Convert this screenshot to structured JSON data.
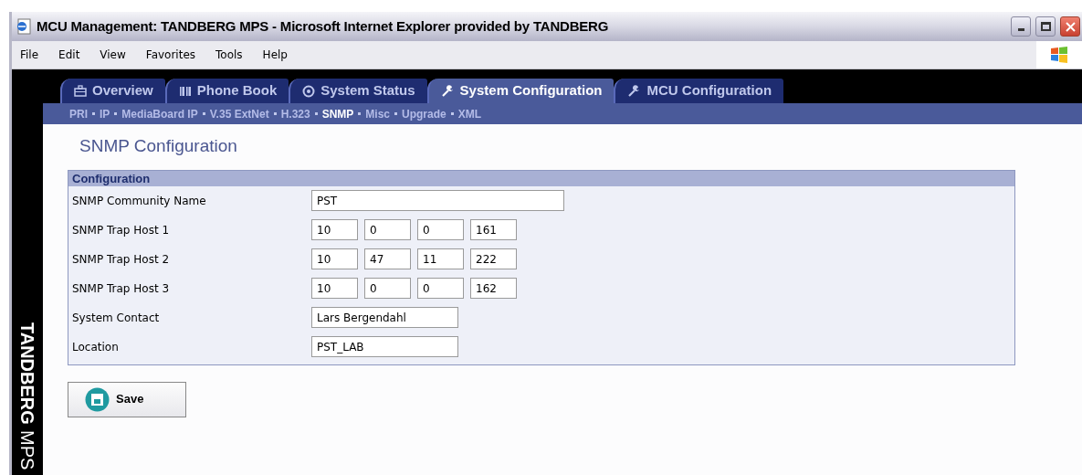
{
  "window": {
    "title": "MCU Management: TANDBERG MPS - Microsoft Internet Explorer provided by TANDBERG"
  },
  "menu": [
    "File",
    "Edit",
    "View",
    "Favorites",
    "Tools",
    "Help"
  ],
  "sidebar": {
    "brand": "TANDBERG",
    "product": "MPS"
  },
  "tabs": [
    {
      "label": "Overview",
      "kind": "briefcase",
      "selected": false
    },
    {
      "label": "Phone Book",
      "kind": "book",
      "selected": false
    },
    {
      "label": "System Status",
      "kind": "gauge",
      "selected": false
    },
    {
      "label": "System Configuration",
      "kind": "wrench",
      "selected": true
    },
    {
      "label": "MCU Configuration",
      "kind": "wrench",
      "selected": false
    }
  ],
  "subnav": [
    {
      "label": "PRI",
      "selected": false
    },
    {
      "label": "IP",
      "selected": false
    },
    {
      "label": "MediaBoard IP",
      "selected": false
    },
    {
      "label": "V.35 ExtNet",
      "selected": false
    },
    {
      "label": "H.323",
      "selected": false
    },
    {
      "label": "SNMP",
      "selected": true
    },
    {
      "label": "Misc",
      "selected": false
    },
    {
      "label": "Upgrade",
      "selected": false
    },
    {
      "label": "XML",
      "selected": false
    }
  ],
  "heading": "SNMP Configuration",
  "panel": {
    "title": "Configuration",
    "rows": [
      {
        "label": "SNMP Community Name",
        "kind": "wide",
        "value": "PST"
      },
      {
        "label": "SNMP Trap Host 1",
        "kind": "ip",
        "parts": [
          "10",
          "0",
          "0",
          "161"
        ]
      },
      {
        "label": "SNMP Trap Host 2",
        "kind": "ip",
        "parts": [
          "10",
          "47",
          "11",
          "222"
        ]
      },
      {
        "label": "SNMP Trap Host 3",
        "kind": "ip",
        "parts": [
          "10",
          "0",
          "0",
          "162"
        ]
      },
      {
        "label": "System Contact",
        "kind": "text",
        "value": "Lars Bergendahl"
      },
      {
        "label": "Location",
        "kind": "text",
        "value": "PST_LAB"
      }
    ]
  },
  "save_button": "Save"
}
